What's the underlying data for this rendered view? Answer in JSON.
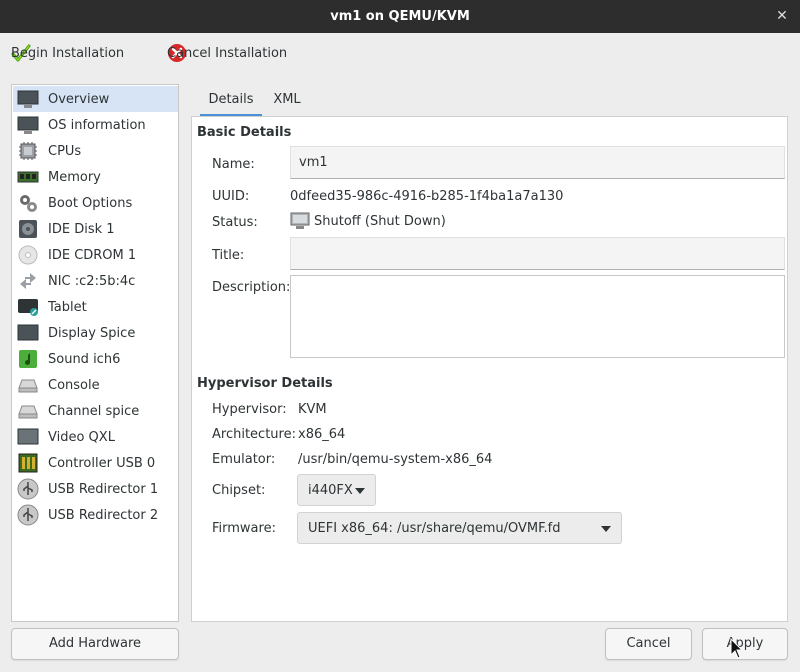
{
  "window": {
    "title": "vm1 on QEMU/KVM"
  },
  "toolbar": {
    "begin_label": "Begin Installation",
    "cancel_label": "Cancel Installation"
  },
  "sidebar": {
    "items": [
      {
        "label": "Overview",
        "icon": "monitor-icon"
      },
      {
        "label": "OS information",
        "icon": "monitor-icon"
      },
      {
        "label": "CPUs",
        "icon": "cpu-icon"
      },
      {
        "label": "Memory",
        "icon": "memory-icon"
      },
      {
        "label": "Boot Options",
        "icon": "gears-icon"
      },
      {
        "label": "IDE Disk 1",
        "icon": "disk-icon"
      },
      {
        "label": "IDE CDROM 1",
        "icon": "cdrom-icon"
      },
      {
        "label": "NIC :c2:5b:4c",
        "icon": "network-icon"
      },
      {
        "label": "Tablet",
        "icon": "tablet-icon"
      },
      {
        "label": "Display Spice",
        "icon": "display-icon"
      },
      {
        "label": "Sound ich6",
        "icon": "sound-icon"
      },
      {
        "label": "Console",
        "icon": "serial-icon"
      },
      {
        "label": "Channel spice",
        "icon": "serial-icon"
      },
      {
        "label": "Video QXL",
        "icon": "video-icon"
      },
      {
        "label": "Controller USB 0",
        "icon": "controller-icon"
      },
      {
        "label": "USB Redirector 1",
        "icon": "usb-icon"
      },
      {
        "label": "USB Redirector 2",
        "icon": "usb-icon"
      }
    ],
    "add_hardware_label": "Add Hardware"
  },
  "tabs": {
    "details": "Details",
    "xml": "XML"
  },
  "basic": {
    "heading": "Basic Details",
    "name_label": "Name:",
    "name_value": "vm1",
    "uuid_label": "UUID:",
    "uuid_value": "0dfeed35-986c-4916-b285-1f4ba1a7a130",
    "status_label": "Status:",
    "status_value": "Shutoff (Shut Down)",
    "title_label": "Title:",
    "title_value": "",
    "description_label": "Description:",
    "description_value": ""
  },
  "hypervisor": {
    "heading": "Hypervisor Details",
    "hypervisor_label": "Hypervisor:",
    "hypervisor_value": "KVM",
    "arch_label": "Architecture:",
    "arch_value": "x86_64",
    "emulator_label": "Emulator:",
    "emulator_value": "/usr/bin/qemu-system-x86_64",
    "chipset_label": "Chipset:",
    "chipset_value": "i440FX",
    "firmware_label": "Firmware:",
    "firmware_value": "UEFI x86_64: /usr/share/qemu/OVMF.fd"
  },
  "footer": {
    "cancel_label": "Cancel",
    "apply_label": "Apply"
  },
  "colors": {
    "selection": "#d6e4f5",
    "accent": "#4a90d9",
    "titlebar": "#2d2d2d"
  }
}
